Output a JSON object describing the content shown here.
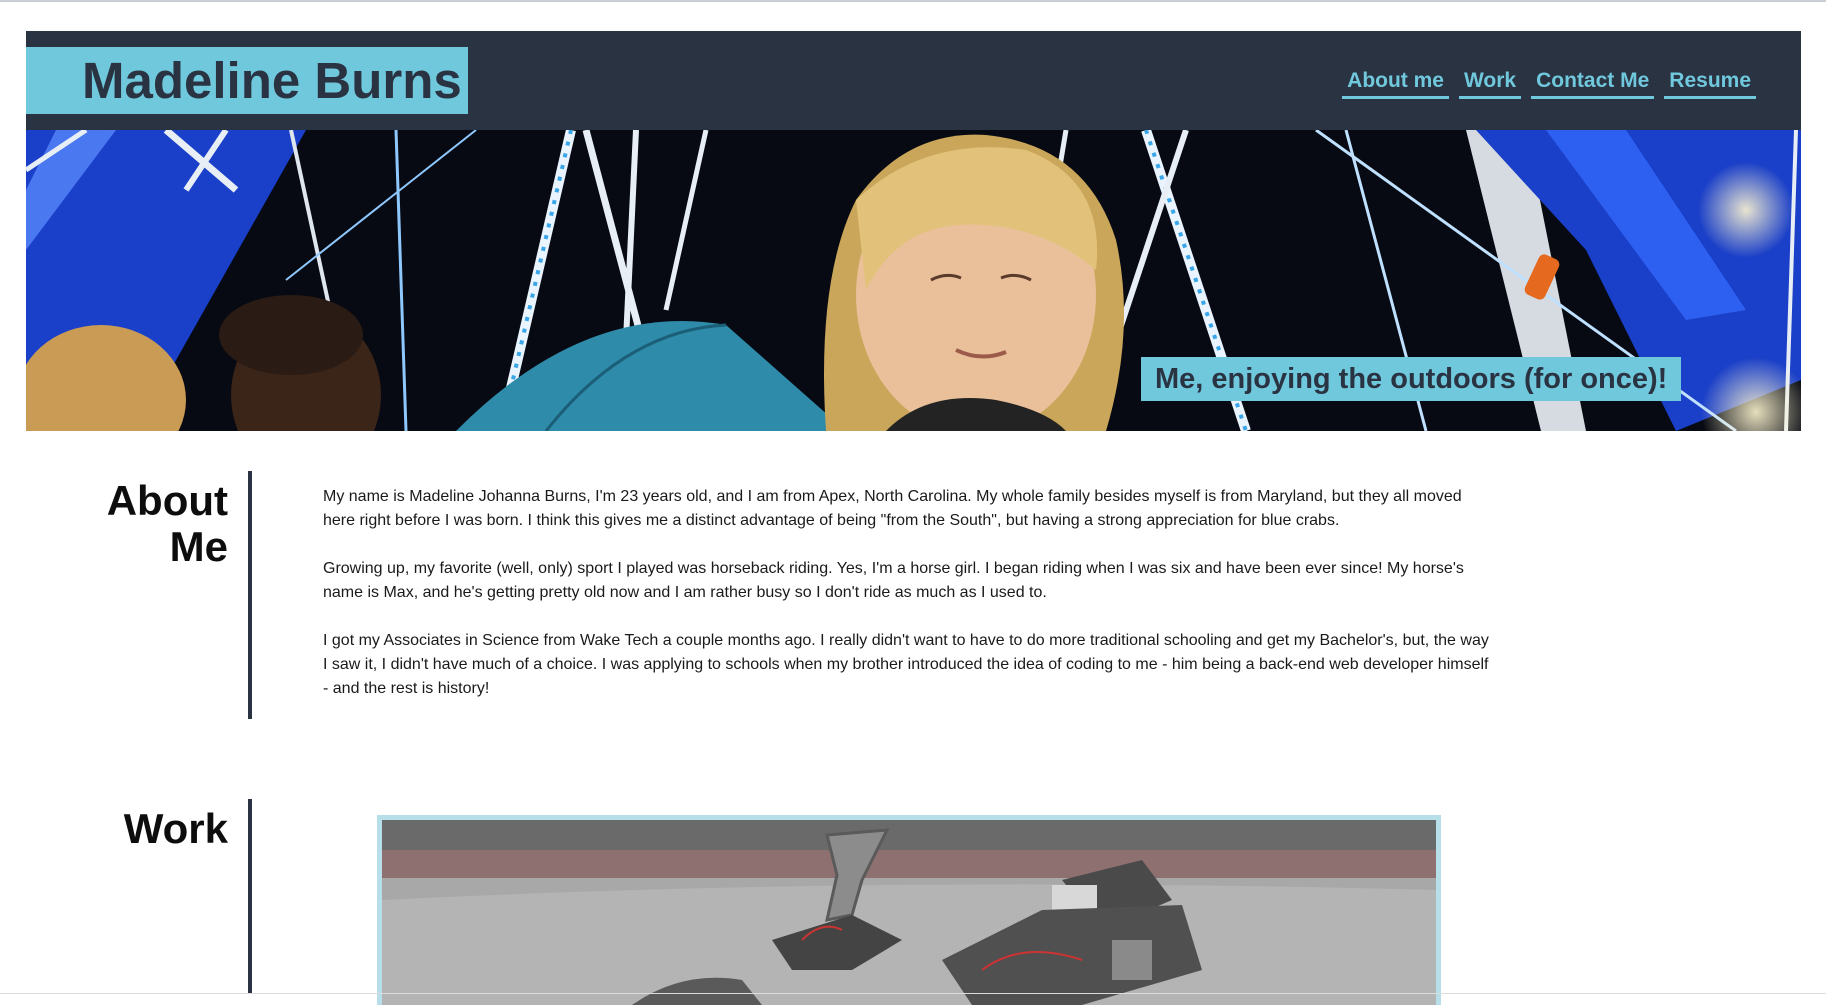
{
  "header": {
    "site_name": "Madeline Burns",
    "nav": [
      "About me",
      "Work",
      "Contact Me",
      "Resume"
    ]
  },
  "hero": {
    "caption": "Me, enjoying the outdoors (for once)!",
    "image_desc": "hero-photo-ferris-wheel-night"
  },
  "about": {
    "title_line1": "About",
    "title_line2": "Me",
    "paragraphs": [
      "My name is Madeline Johanna Burns, I'm 23 years old, and I am from Apex, North Carolina. My whole family besides myself is from Maryland, but they all moved here right before I was born. I think this gives me a distinct advantage of being \"from the South\", but having a strong appreciation for blue crabs.",
      "Growing up, my favorite (well, only) sport I played was horseback riding. Yes, I'm a horse girl. I began riding when I was six and have been ever since! My horse's name is Max, and he's getting pretty old now and I am rather busy so I don't ride as much as I used to.",
      "I got my Associates in Science from Wake Tech a couple months ago. I really didn't want to have to do more traditional schooling and get my Bachelor's, but, the way I saw it, I didn't have much of a choice. I was applying to schools when my brother introduced the idea of coding to me - him being a back-end web developer himself - and the rest is history!"
    ]
  },
  "work": {
    "title": "Work",
    "image_desc": "work-photo-robot"
  },
  "colors": {
    "navy": "#2a3342",
    "accent": "#70c8dd",
    "text": "#1a1a1a"
  }
}
